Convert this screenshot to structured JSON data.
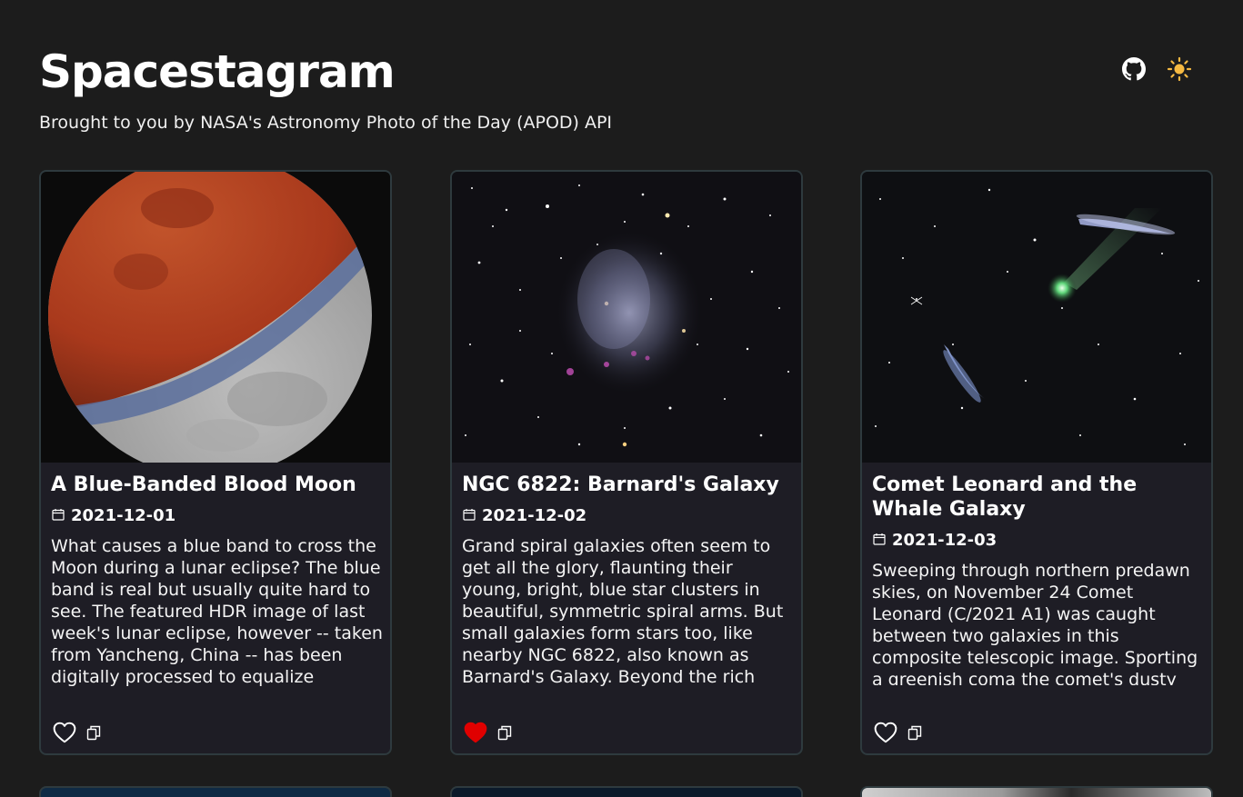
{
  "header": {
    "title": "Spacestagram",
    "subtitle": "Brought to you by NASA's Astronomy Photo of the Day (APOD) API",
    "github_icon": "github-icon",
    "theme_icon": "sun-icon"
  },
  "colors": {
    "background": "#1c1c1c",
    "card_background": "#1e1d25",
    "card_border": "#2e3a3e",
    "sun": "#f5b942",
    "liked_heart": "#e00000"
  },
  "cards": [
    {
      "title": "A Blue-Banded Blood Moon",
      "date": "2021-12-01",
      "description": "What causes a blue band to cross the Moon during a lunar eclipse? The blue band is real but usually quite hard to see. The featured HDR image of last week's lunar eclipse, however -- taken from Yancheng, China -- has been digitally processed to equalize",
      "liked": false
    },
    {
      "title": "NGC 6822: Barnard's Galaxy",
      "date": "2021-12-02",
      "description": "Grand spiral galaxies often seem to get all the glory, flaunting their young, bright, blue star clusters in beautiful, symmetric spiral arms. But small galaxies form stars too, like nearby NGC 6822, also known as Barnard's Galaxy. Beyond the rich starfields in",
      "liked": true
    },
    {
      "title": "Comet Leonard and the Whale Galaxy",
      "date": "2021-12-03",
      "description": "Sweeping through northern predawn skies, on November 24 Comet Leonard (C/2021 A1) was caught between two galaxies in this composite telescopic image. Sporting a greenish coma the comet's dusty",
      "liked": false
    }
  ]
}
